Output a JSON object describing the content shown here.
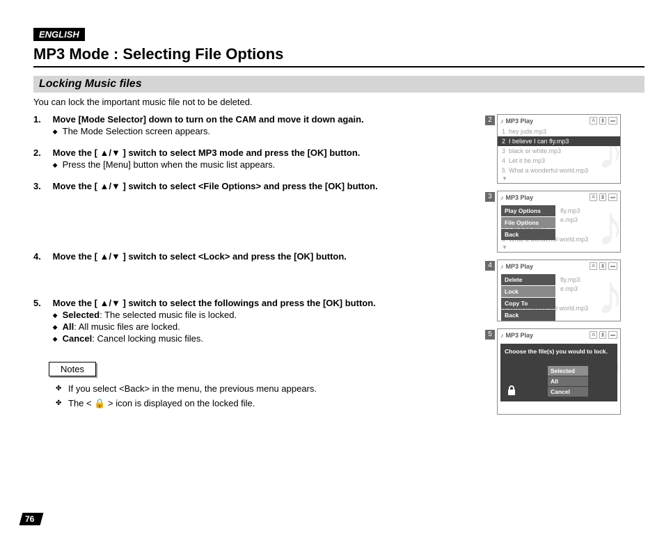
{
  "lang_badge": "ENGLISH",
  "title": "MP3 Mode : Selecting File Options",
  "subtitle": "Locking Music files",
  "intro": "You can lock the important music file not to be deleted.",
  "steps": [
    {
      "num": "1.",
      "head": "Move [Mode Selector] down to turn on the CAM and move it down again.",
      "subs": [
        "The Mode Selection screen appears."
      ]
    },
    {
      "num": "2.",
      "head": "Move the [ ▲/▼ ] switch to select MP3 mode and press the [OK] button.",
      "subs": [
        "Press the [Menu] button when the music list appears."
      ]
    },
    {
      "num": "3.",
      "head": "Move the [ ▲/▼ ] switch to select <File Options> and press the [OK] button.",
      "subs": []
    },
    {
      "num": "4.",
      "head": "Move the [ ▲/▼ ] switch to select <Lock> and press the [OK] button.",
      "subs": []
    },
    {
      "num": "5.",
      "head": "Move the [ ▲/▼ ] switch to select the followings and press the [OK] button.",
      "subs": [
        "<b>Selected</b>: The selected music file is locked.",
        "<b>All</b>: All music files are locked.",
        "<b>Cancel</b>: Cancel locking music files."
      ]
    }
  ],
  "notes_label": "Notes",
  "notes": [
    "If you select <Back> in the menu, the previous menu appears.",
    "The < 🔒 > icon is displayed on the locked file."
  ],
  "page_number": "76",
  "screen_header": "MP3 Play",
  "playlist": [
    {
      "n": "1",
      "t": "hey jude.mp3"
    },
    {
      "n": "2",
      "t": "I believe I can fly.mp3"
    },
    {
      "n": "3",
      "t": "black or white.mp3"
    },
    {
      "n": "4",
      "t": "Let it be.mp3"
    },
    {
      "n": "5",
      "t": "What a wonderful world.mp3"
    }
  ],
  "menu3": [
    "Play Options",
    "File Options",
    "Back"
  ],
  "menu4": [
    "Delete",
    "Lock",
    "Copy To",
    "Back"
  ],
  "confirm_msg": "Choose the file(s) you would to lock.",
  "confirm_opts": [
    "Selected",
    "All",
    "Cancel"
  ],
  "badges": {
    "b2": "2",
    "b3": "3",
    "b4": "4",
    "b5": "5"
  },
  "partial": {
    "fly": "fly.mp3",
    "emp3": "e.mp3"
  }
}
